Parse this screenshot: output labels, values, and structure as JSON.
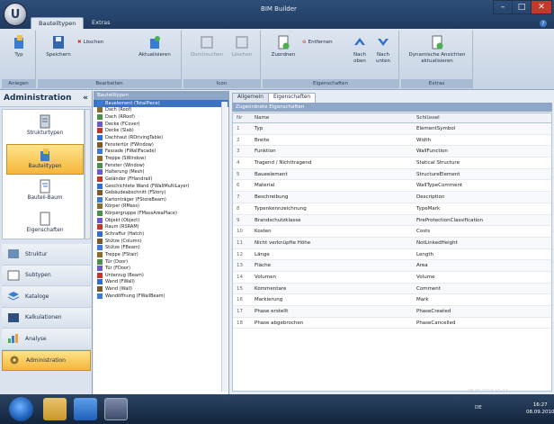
{
  "titlebar": {
    "app_title": "BIM Builder",
    "tabs": [
      "Bauteiltypen",
      "Extras"
    ],
    "orb_letter": "U",
    "controls": [
      "–",
      "□",
      "✕"
    ],
    "help": "?"
  },
  "ribbon": {
    "groups": [
      {
        "label": "Anlegen",
        "buttons": [
          "Typ"
        ]
      },
      {
        "label": "Bearbeiten",
        "buttons": [
          "Speichern",
          "Löschen",
          "Aktualisieren"
        ]
      },
      {
        "label": "Icon",
        "buttons": [
          "Durchsuchen",
          "Löschen"
        ]
      },
      {
        "label": "Eigenschaften",
        "buttons": [
          "Zuordnen",
          "Entfernen",
          "Nach oben",
          "Nach unten"
        ]
      },
      {
        "label": "Extras",
        "buttons": [
          "Dynamische Ansichten aktualisieren"
        ]
      }
    ]
  },
  "nav": {
    "title": "Administration",
    "big_items": [
      {
        "label": "Strukturtypen",
        "selected": false
      },
      {
        "label": "Bauteiltypen",
        "selected": true
      },
      {
        "label": "Bauteil-Baum",
        "selected": false
      },
      {
        "label": "Eigenschaften",
        "selected": false
      }
    ],
    "list_items": [
      {
        "label": "Struktur",
        "selected": false
      },
      {
        "label": "Subtypen",
        "selected": false
      },
      {
        "label": "Kataloge",
        "selected": false
      },
      {
        "label": "Kalkulationen",
        "selected": false
      },
      {
        "label": "Analyse",
        "selected": false
      },
      {
        "label": "Administration",
        "selected": true
      }
    ]
  },
  "tree": {
    "header": "Bauteiltypen",
    "items": [
      "Bauelement (TotalPiece)",
      "Dach (Roof)",
      "Dach (RRoof)",
      "Decke (FCover)",
      "Decke (Slab)",
      "Dachhaut (RDrivingTable)",
      "Fenstertür (FWindow)",
      "Fassade (FWallFacade)",
      "Treppe (SWindow)",
      "Fenster (Window)",
      "Halterung (Mesh)",
      "Geländer (FHandrail)",
      "Geschichtete Wand (FWallMultiLayer)",
      "Gebäudeabschnitt (FStory)",
      "Kartonträger (FStoreBeam)",
      "Körper (RMass)",
      "Körpergruppe (FMassAreaPlace)",
      "Objekt (Object)",
      "Raum (RSRAM)",
      "Schraffur (Hatch)",
      "Stütze (Column)",
      "Stütze (FBeam)",
      "Treppe (FStair)",
      "Tür (Door)",
      "Tür (FDoor)",
      "Unterzug (Beam)",
      "Wand (FWall)",
      "Wand (Wall)",
      "Wandöffnung (FWallBeam)"
    ],
    "selected_index": 0
  },
  "main": {
    "tabs": [
      "Allgemein",
      "Eigenschaften"
    ],
    "active_tab": 1,
    "grid_title": "Zugeordnete Eigenschaften",
    "columns": [
      "Nr",
      "Name",
      "Schlüssel"
    ],
    "rows": [
      [
        "1",
        "Typ",
        "ElementSymbol"
      ],
      [
        "2",
        "Breite",
        "Width"
      ],
      [
        "3",
        "Funktion",
        "WallFunction"
      ],
      [
        "4",
        "Tragend / Nichttragend",
        "Statical Structure"
      ],
      [
        "5",
        "Baueelement",
        "StructureElement"
      ],
      [
        "6",
        "Material",
        "WallTypeComment"
      ],
      [
        "7",
        "Beschreibung",
        "Description"
      ],
      [
        "8",
        "Typenkennzeichnung",
        "TypeMark"
      ],
      [
        "9",
        "Brandschutzklasse",
        "FireProtectionClassification"
      ],
      [
        "10",
        "Kosten",
        "Costs"
      ],
      [
        "11",
        "Nicht verknüpfte Höhe",
        "NotLinkedHeight"
      ],
      [
        "12",
        "Länge",
        "Length"
      ],
      [
        "13",
        "Fläche",
        "Area"
      ],
      [
        "14",
        "Volumen",
        "Volume"
      ],
      [
        "15",
        "Kommentare",
        "Comment"
      ],
      [
        "16",
        "Markierung",
        "Mark"
      ],
      [
        "17",
        "Phase erstellt",
        "PhaseCreated"
      ],
      [
        "18",
        "Phase abgebrochen",
        "PhaseCancelled"
      ]
    ]
  },
  "taskbar": {
    "clock_time": "16:27",
    "clock_date": "08.09.2010",
    "tray_text": "DE",
    "status": "08.09.2010  16:27"
  },
  "colors": {
    "accent": "#3b73c2",
    "selection": "#f5b63a",
    "header": "#8fa7c6"
  }
}
